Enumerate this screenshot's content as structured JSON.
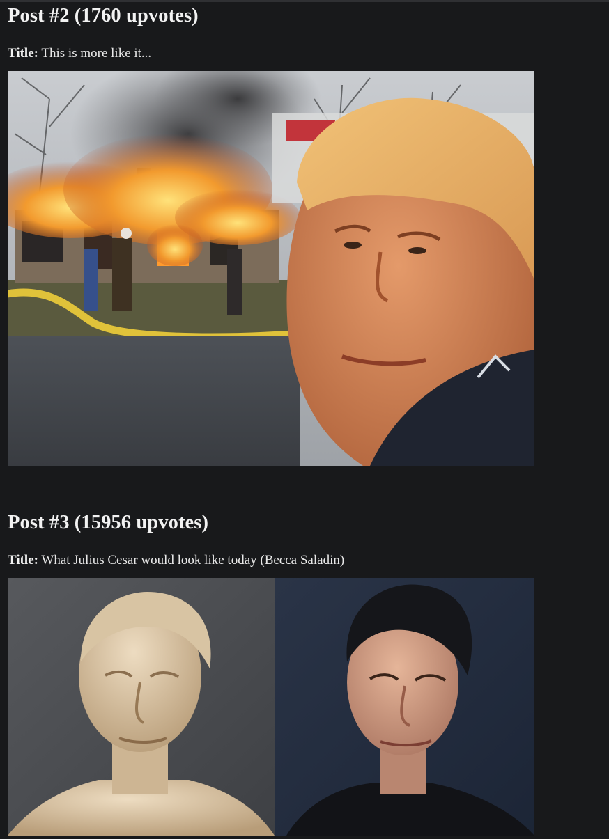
{
  "posts": [
    {
      "heading": "Post #2 (1760 upvotes)",
      "title_label": "Title:",
      "title_text": " This is more like it...",
      "image": {
        "subject_icon": "burning-house-meme-photo-icon"
      }
    },
    {
      "heading": "Post #3 (15956 upvotes)",
      "title_label": "Title:",
      "title_text": " What Julius Cesar would look like today (Becca Saladin)",
      "image": {
        "subject_icon": "bust-and-portrait-comparison-photo-icon"
      }
    }
  ],
  "colors": {
    "background": "#18191b",
    "text": "#e6e6e6",
    "accent_fire": "#f29a2e"
  }
}
